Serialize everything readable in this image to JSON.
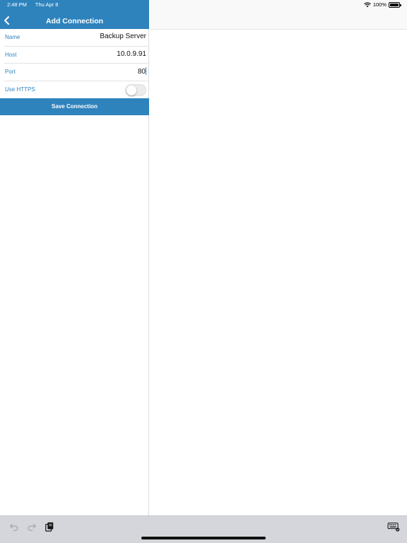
{
  "status": {
    "time": "2:48 PM",
    "date": "Thu Apr 8",
    "battery": "100%",
    "battery_level": 1.0
  },
  "nav": {
    "title": "Add Connection"
  },
  "form": {
    "rows": [
      {
        "label": "Name",
        "value": "Backup Server"
      },
      {
        "label": "Host",
        "value": "10.0.9.91"
      },
      {
        "label": "Port",
        "value": "80"
      }
    ],
    "https": {
      "label": "Use HTTPS",
      "on": false
    }
  },
  "actions": {
    "save_label": "Save Connection"
  },
  "colors": {
    "accent": "#2f83bd",
    "shortcut_bar": "#d4d6db"
  },
  "icons": {
    "back": "chevron-left-icon",
    "undo": "undo-icon",
    "redo": "redo-icon",
    "paste": "clipboard-icon",
    "keyboard": "keyboard-dismiss-icon",
    "wifi": "wifi-icon",
    "battery": "battery-icon"
  }
}
